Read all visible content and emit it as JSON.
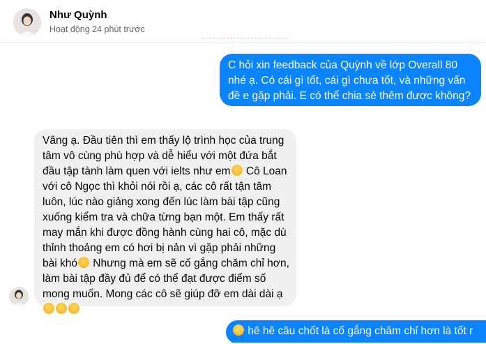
{
  "header": {
    "name": "Như Quỳnh",
    "status": "Hoạt động 24 phút trước",
    "avatar_icon": "profile-photo"
  },
  "messages": {
    "outgoing_1": [
      "C hỏi xin feedback của Quỳnh về lớp Overall 80",
      "nhé ạ. Có cái gì tốt, cái gì chưa tốt, và những vấn",
      "đề e gặp phải. E có thể chia sẻ thêm được không?"
    ],
    "incoming_1": [
      "Vâng ạ. Đầu tiên thì em thấy lộ trình học của trung",
      "tâm vô cùng phù hợp và dễ hiểu với một đứa bắt",
      "đầu tập tành làm quen với ielts như em",
      "Cô Loan",
      "với cô Ngọc thì khỏi nói rồi ạ, các cô rất tận tâm",
      "luôn, lúc nào giảng xong đến lúc làm bài tập cũng",
      "xuống kiểm tra và chữa từng bạn một. Em thấy rất",
      "may mắn khi được đồng hành cùng hai cô, mặc dù",
      "thỉnh thoảng em có hơi bị nản vì gặp phải những",
      "bài khó",
      "Nhưng mà em sẽ cố gắng chăm chỉ hơn,",
      "làm bài tập đầy đủ để có thể đạt được điểm số",
      "mong muốn. Mong các cô sẽ giúp đỡ em dài dài ạ"
    ],
    "outgoing_2": "hê hê câu chốt là cố gắng chăm chỉ hơn là tốt r"
  },
  "colors": {
    "outgoing_bubble": "#0a84ff",
    "incoming_bubble": "#f0f0f0",
    "status_text": "#65676b"
  },
  "emoji": {
    "crying": "crying-face",
    "smile": "smiling-face"
  }
}
